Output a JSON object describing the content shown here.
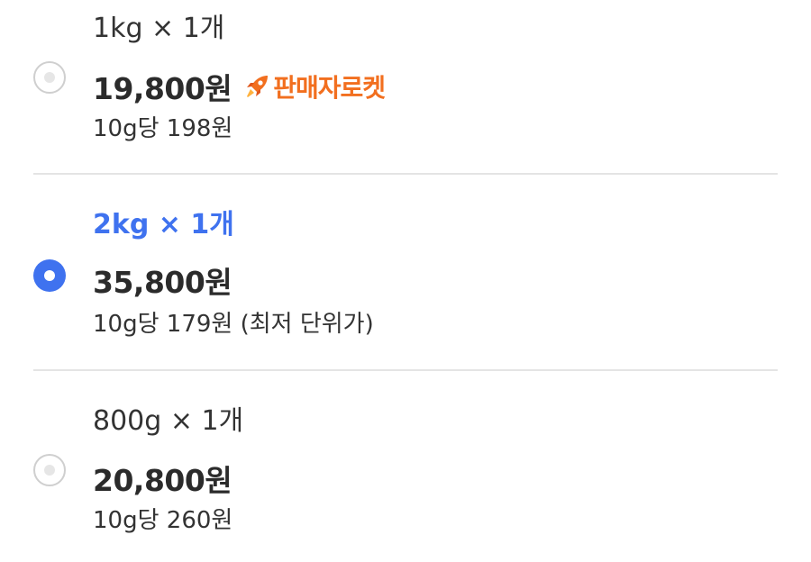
{
  "options": [
    {
      "quantity_label": "1kg × 1개",
      "price": "19,800원",
      "badge": {
        "icon": "rocket-icon",
        "text": "판매자로켓",
        "color": "#f26f1f"
      },
      "unit_price": "10g당 198원",
      "selected": false
    },
    {
      "quantity_label": "2kg × 1개",
      "price": "35,800원",
      "unit_price": "10g당 179원 (최저 단위가)",
      "selected": true
    },
    {
      "quantity_label": "800g × 1개",
      "price": "20,800원",
      "unit_price": "10g당 260원",
      "selected": false
    }
  ],
  "colors": {
    "accent": "#3f72ef",
    "text": "#2b2b2b",
    "divider": "#e4e4e4",
    "radio_off": "#cfcfcf"
  }
}
